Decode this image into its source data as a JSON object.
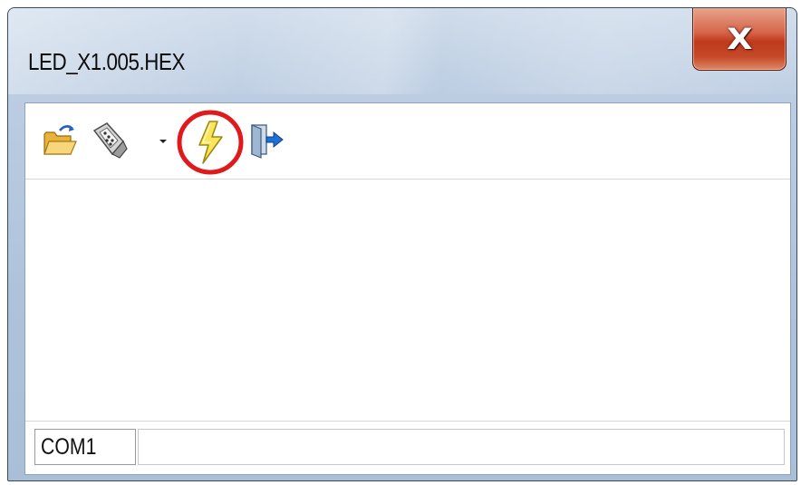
{
  "window": {
    "title": "LED_X1.005.HEX",
    "close_label": "X"
  },
  "toolbar": {
    "items": [
      {
        "name": "open-file",
        "icon": "open-folder-icon"
      },
      {
        "name": "connect",
        "icon": "serial-connector-icon"
      },
      {
        "name": "connect-dropdown",
        "icon": "dropdown-arrow-icon"
      },
      {
        "name": "flash",
        "icon": "lightning-bolt-icon",
        "highlighted": true
      },
      {
        "name": "exit",
        "icon": "exit-door-icon"
      }
    ],
    "highlight_color": "#e01a1a"
  },
  "statusbar": {
    "port": "COM1"
  }
}
